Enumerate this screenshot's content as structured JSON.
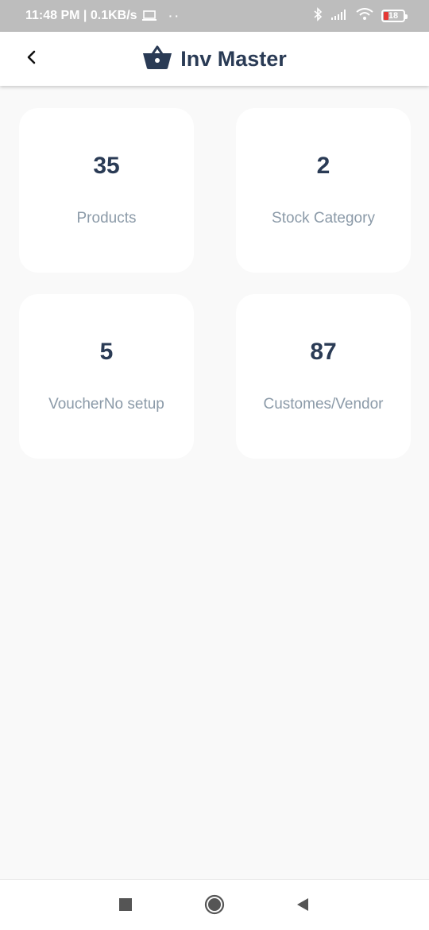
{
  "status_bar": {
    "time_speed": "11:48 PM | 0.1KB/s",
    "dots": "··",
    "battery": "18",
    "battery_color": "#e53935"
  },
  "app_bar": {
    "title": "Inv Master",
    "back_icon": "chevron-left-icon",
    "logo_icon": "basket-icon"
  },
  "theme": {
    "primary_text": "#2a3b55",
    "label_text": "#8b9aa8",
    "card_bg": "#ffffff",
    "page_bg": "#f9f9f9"
  },
  "cards": [
    {
      "value": "35",
      "label": "Products"
    },
    {
      "value": "2",
      "label": "Stock Category"
    },
    {
      "value": "5",
      "label": "VoucherNo setup"
    },
    {
      "value": "87",
      "label": "Customes/Vendor"
    }
  ],
  "nav_bar": {
    "icons": [
      "recents-square-icon",
      "home-circle-icon",
      "back-triangle-icon"
    ]
  }
}
